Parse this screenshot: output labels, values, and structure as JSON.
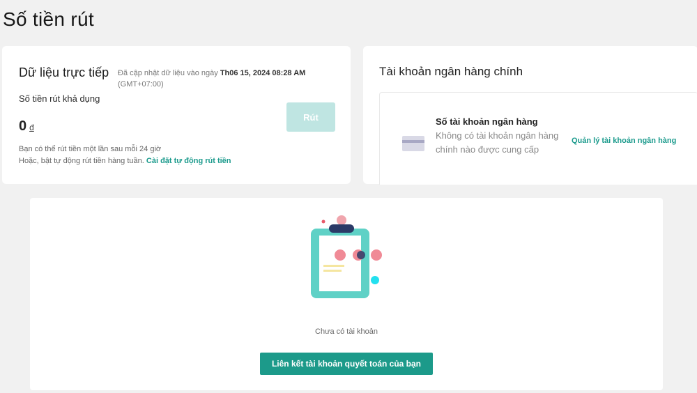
{
  "page": {
    "title": "Số tiền rút"
  },
  "live": {
    "title": "Dữ liệu trực tiếp",
    "updated_prefix": "Đã cập nhật dữ liệu vào ngày",
    "updated_datetime": "Th06 15, 2024 08:28 AM",
    "timezone": "(GMT+07:00)",
    "available_label": "Số tiền rút khả dụng",
    "amount": "0",
    "currency": "đ",
    "withdraw_label": "Rút",
    "note_line1": "Bạn có thể rút tiền một lần sau mỗi 24 giờ",
    "note_line2": "Hoặc, bật tự động rút tiền hàng tuần.",
    "auto_withdraw_link": "Cài đặt tự động rút tiền"
  },
  "bank": {
    "title": "Tài khoản ngân hàng chính",
    "account_title": "Số tài khoản ngân hàng",
    "account_desc": "Không có tài khoản ngân hàng chính nào được cung cấp",
    "manage_link": "Quản lý tài khoản ngân hàng"
  },
  "empty": {
    "message": "Chưa có tài khoản",
    "link_button": "Liên kết tài khoản quyết toán của bạn"
  },
  "colors": {
    "accent": "#1c9a8a",
    "accent_disabled": "#bfe5e2",
    "background": "#f1f1f1"
  }
}
